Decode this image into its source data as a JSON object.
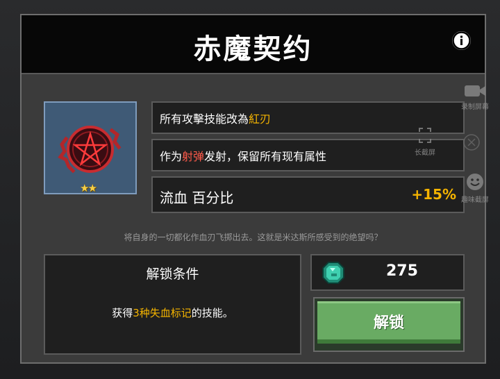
{
  "dialog": {
    "title": "赤魔契约"
  },
  "item": {
    "stars": "★★",
    "icon": "pentagram-icon"
  },
  "effects": {
    "line1_prefix": "所有攻擊技能改為",
    "line1_highlight": "紅刃",
    "line2_prefix": "作为",
    "line2_highlight": "射弹",
    "line2_suffix": "发射，保留所有现有属性",
    "stat_name": "流血 百分比",
    "stat_value": "+15%"
  },
  "flavor_text": "将自身的一切都化作血刃飞掷出去。这就是米达斯所感受到的绝望吗？",
  "unlock": {
    "title": "解锁条件",
    "text_prefix": "获得",
    "text_count": "3种",
    "text_highlight": "失血标记",
    "text_suffix": "的技能。"
  },
  "cost": {
    "value": "275",
    "icon": "gem-icon"
  },
  "unlock_button": {
    "label": "解锁"
  },
  "overlay": {
    "record_label": "录制屏幕",
    "long_label": "长截屏",
    "fun_label": "趣味截屏"
  },
  "colors": {
    "highlight": "#f5b400",
    "projectile_red": "#ff5a4a",
    "button_green": "#69ab63"
  }
}
